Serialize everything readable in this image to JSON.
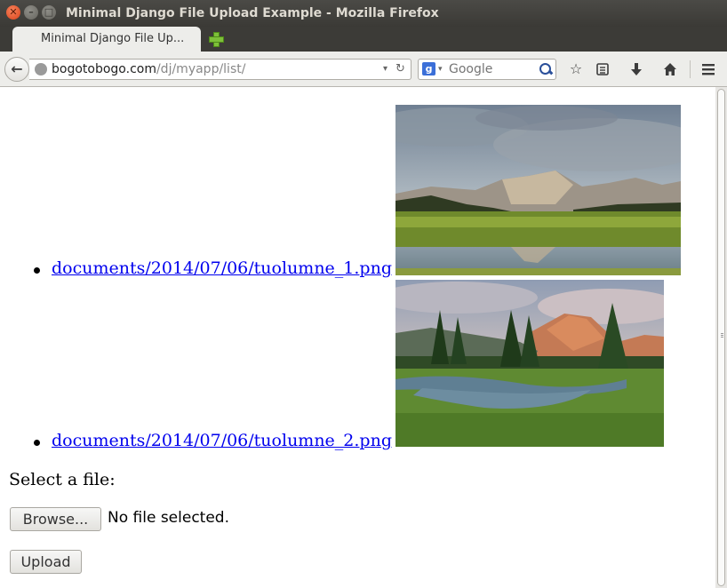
{
  "window": {
    "title": "Minimal Django File Upload Example - Mozilla Firefox",
    "close_glyph": "✕",
    "min_glyph": "–",
    "max_glyph": "□"
  },
  "tabs": [
    {
      "label": "Minimal Django File Up...",
      "active": true
    }
  ],
  "navbar": {
    "back_glyph": "←",
    "url_host": "bogotobogo.com",
    "url_path": "/dj/myapp/list/",
    "reload_glyph": "↻",
    "dropdown_glyph": "▾",
    "search_engine_letter": "g",
    "search_placeholder": "Google",
    "icons": [
      "bookmark-star-icon",
      "reading-list-icon",
      "downloads-icon",
      "home-icon",
      "menu-icon"
    ]
  },
  "content": {
    "documents": [
      {
        "link_text": "documents/2014/07/06/tuolumne_1.png",
        "image": "landscape-meadow-mountain-reflection"
      },
      {
        "link_text": "documents/2014/07/06/tuolumne_2.png",
        "image": "landscape-river-pines-sunset"
      }
    ],
    "select_label": "Select a file:",
    "browse_label": "Browse...",
    "file_status": "No file selected.",
    "upload_label": "Upload"
  },
  "colors": {
    "link": "#0000ee",
    "titlebar": "#3b3a36",
    "chrome": "#ededea"
  }
}
